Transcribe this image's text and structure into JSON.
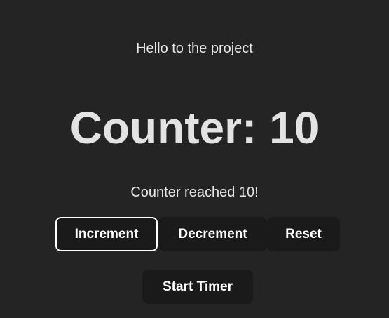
{
  "app": {
    "greeting": "Hello to the project",
    "counter_title": "Counter: 10",
    "counter_message": "Counter reached 10!"
  },
  "controls": {
    "increment_label": "Increment",
    "decrement_label": "Decrement",
    "reset_label": "Reset",
    "timer_label": "Start Timer"
  },
  "state": {
    "counter_value": 10,
    "focused_button": "Increment"
  },
  "colors": {
    "background": "#242424",
    "button_background": "#1a1a1a",
    "text": "#e6e6e6",
    "focus_outline": "#ffffff"
  }
}
